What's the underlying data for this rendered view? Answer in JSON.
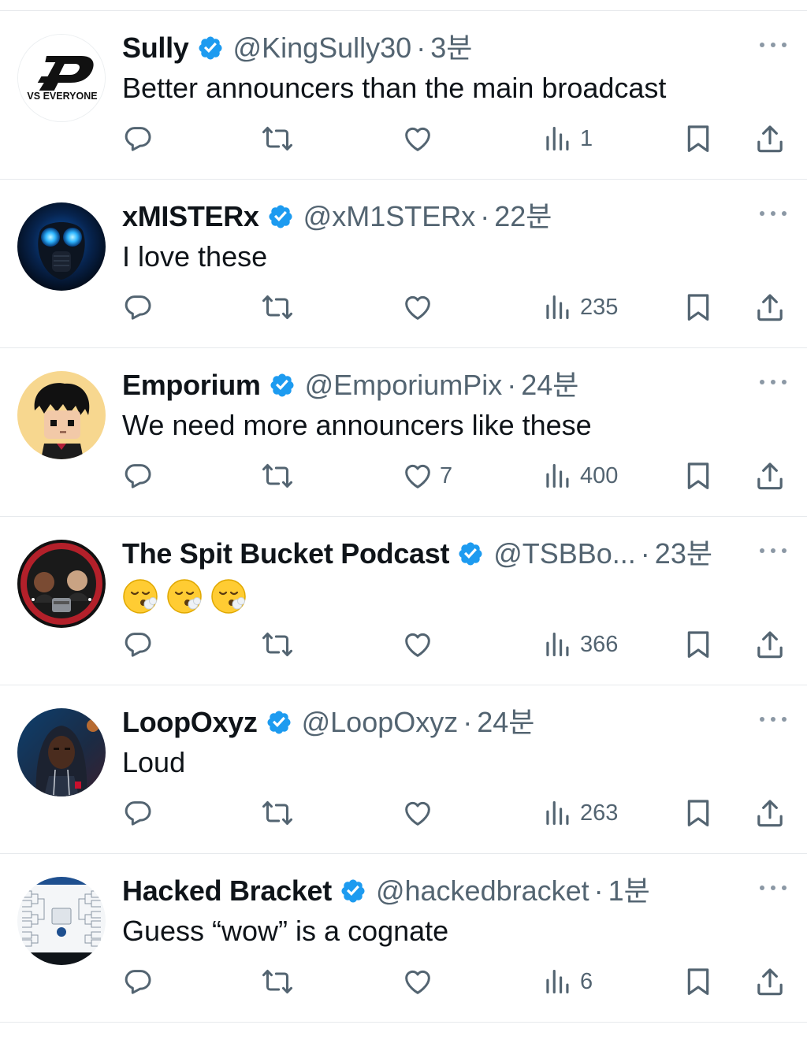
{
  "tweets": [
    {
      "name": "Sully",
      "handle": "@KingSully30",
      "separator": "·",
      "time": "3분",
      "text": "Better announcers than the main broadcast",
      "likes": "",
      "views": "1",
      "avatar_text": "VS EVERYONE"
    },
    {
      "name": "xMISTERx",
      "handle": "@xM1STERx",
      "separator": "·",
      "time": "22분",
      "text": "I love these",
      "likes": "",
      "views": "235"
    },
    {
      "name": "Emporium",
      "handle": "@EmporiumPix",
      "separator": "·",
      "time": "24분",
      "text": "We need more announcers like these",
      "likes": "7",
      "views": "400"
    },
    {
      "name": "The Spit Bucket Podcast",
      "handle": "@TSBBo...",
      "separator": "·",
      "time": "23분",
      "text": "",
      "likes": "",
      "views": "366"
    },
    {
      "name": "LoopOxyz",
      "handle": "@LoopOxyz",
      "separator": "·",
      "time": "24분",
      "text": "Loud",
      "likes": "",
      "views": "263"
    },
    {
      "name": "Hacked Bracket",
      "handle": "@hackedbracket",
      "separator": "·",
      "time": "1분",
      "text": "Guess “wow” is a cognate",
      "likes": "",
      "views": "6"
    }
  ],
  "colors": {
    "verified": "#1d9bf0",
    "muted": "#536471",
    "text": "#0f1419",
    "divider": "#e6e9ec"
  },
  "icons": {
    "reply": "speech-bubble-icon",
    "retweet": "retweet-arrows-icon",
    "like": "heart-icon",
    "views": "bar-chart-icon",
    "bookmark": "bookmark-icon",
    "share": "share-upload-icon",
    "more": "ellipsis-icon",
    "verified": "verified-badge-icon"
  }
}
